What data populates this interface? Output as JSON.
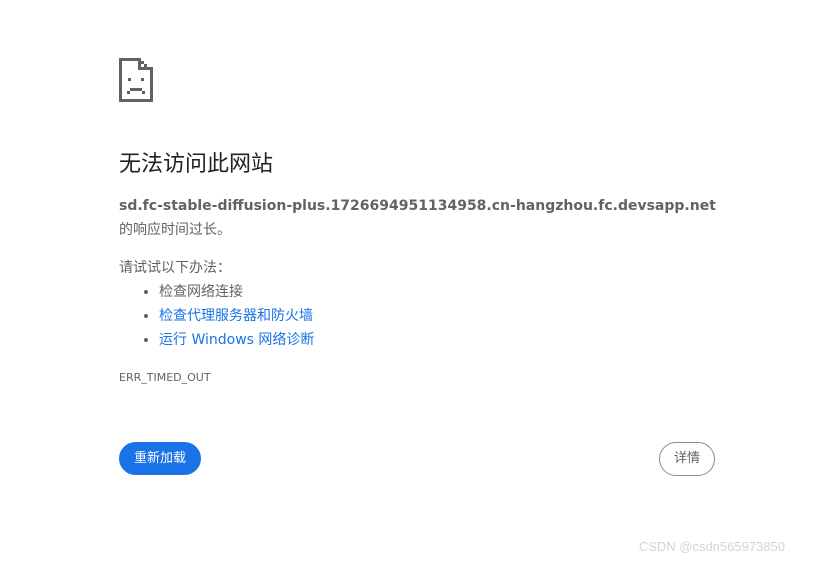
{
  "error": {
    "title": "无法访问此网站",
    "host": "sd.fc-stable-diffusion-plus.1726694951134958.cn-hangzhou.fc.devsapp.net",
    "message_suffix": " 的响应时间过长。",
    "suggest_intro": "请试试以下办法：",
    "suggestions": [
      {
        "label": "检查网络连接",
        "link": false
      },
      {
        "label": "检查代理服务器和防火墙",
        "link": true
      },
      {
        "label": "运行 Windows 网络诊断",
        "link": true
      }
    ],
    "code": "ERR_TIMED_OUT",
    "icon": "sad-page-icon"
  },
  "buttons": {
    "reload_label": "重新加载",
    "details_label": "详情"
  },
  "watermark": "CSDN @csdn565973850",
  "colors": {
    "accent": "#1a73e8",
    "text": "#202124",
    "secondary_text": "#5f6368"
  }
}
